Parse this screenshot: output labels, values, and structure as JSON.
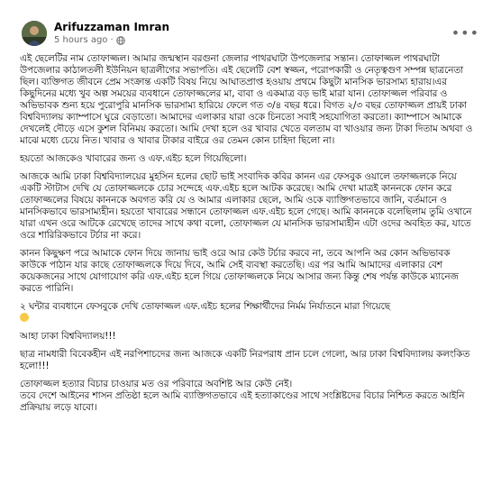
{
  "post": {
    "author": "Arifuzzaman Imran",
    "time": "5 hours ago",
    "separator": "·",
    "privacy_icon": "globe-icon",
    "menu_icon": "more-options-icon",
    "paragraphs": [
      "এই ছেলেটির নাম তোফাজ্জল। আমার জন্মস্থান বরগুনা জেলার পাথরঘাটা উপজেলার সন্তান। তোফাজ্জল পাথরঘাটা উপজেলার কাঠালতলী ইউনিয়ন ছাত্রলীগের সভাপতি। এই ছেলেটি বেশ স্বজ্জন, পরোপকারী ও নেতৃত্বগুণ সম্পন্ন ছাত্রনেতা ছিল। ব্যক্তিগত জীবনে প্রেম সংক্রান্ত একটি বিষয় নিয়ে আঘাতপ্রাপ্ত হওয়ায় প্রথমে কিছুটা মানসিক ভারসাম্য হারায়।এর কিছুদিনের মধ্যে খুব অল্প সময়ের ব্যবধানে তোফাজ্জলের মা, বাবা ও একমাত্র বড় ভাই মারা যান। তোফাজ্জল পরিবার ও অভিভাবক শুন্য হয়ে পুরোপুরি মানসিক ভারসাম্য হারিয়ে ফেলে গত ৩/৪ বছর ধরে। বিগত ২/৩ বছর তোফাজ্জল প্রায়ই ঢাকা বিশ্ববিদ্যালয় ক্যাম্পাসে ঘুরে বেড়াতো। আমাদের এলাকার যারা ওকে চিনতো সবাই সহযোগিতা করতো। ক্যাম্পাসে আমাকে দেখলেই দৌড়ে এসে কুশল বিনিময় করতো। আমি দেখা হলে ওর খাবার খেতে বলতাম বা খাওয়ার জন্য টাকা দিতাম অথবা ও মাঝে মধ্যে চেয়ে নিত। খাবার ও খাবার টাকার বাইরে ওর তেমন কোন চাহিদা ছিলো না।",
      "হয়তো আজকেও খাবারের জন্য ও এফ.এইচ হলে গিয়েছিলো।",
      "আজকে আমি ঢাকা বিশ্ববিদ্যালয়ের মুহসিন হলের ছোট ভাই সংবাদিক কবির কানন এর ফেসবুক ওয়ালে তফাজ্জলকে নিয়ে একটি স্টাটাস দেখি যে তোফাজ্জলকে চোর সন্দেহে এফ.এইচ হলে আটক করেছে। আমি দেখা মাত্রই কাননকে ফোন করে তোফাজ্জলের বিষয়ে কাননকে অবগত করি যে ও আমার এলাকার ছেলে, আমি ওকে ব্যাক্তিগতভাবে জানি, বর্তমানে ও মানসিকভাবে ভারসাম্যহীন। হয়তো খাবারের সন্ধানে তোফাজ্জল এফ.এইচ হলে গেছে। আমি কাননকে বলেছিলাম তুমি ওখানে যারা এখন ওরে আটকে রেখেছে তাদের সাথে কথা বলো, তোফাজ্জল যে মানসিক ভারসাম্যহীন এটা ওদের অবহিত কর, যাতে ওরে শারিরিকভাবে টর্চার না করে।",
      "কানন কিছুক্ষণ পরে আমাকে ফোন দিয়ে জানায় ভাই ওরে আর কেউ টর্চার করবে না, তবে আপনি অর কোন অভিভাবক কাউকে পাঠান যার কাছে তোফাজ্জলকে দিয়ে দিবে, আমি সেই ব্যবস্থা করতেছি। এর পর আমি আমাদের এলাকার বেশ কয়েকজনের সাথে যোগাযোগ করি এফ.এইচ হলে গিয়ে তোফাজ্জলকে নিয়ে আসার জন্য কিন্তু শেষ পর্যন্ত কাউকে ম্যানেজ করতে পারিনি।",
      "২ ঘন্টার ব্যবধানে ফেসবুকে দেখি তোফাজ্জল এফ.এইচ হলের শিক্ষার্থীদের নির্মম নির্যাতনে মারা গিয়েছে",
      "আহা ঢাকা বিশ্ববিদ্যালয়!!!",
      "ছাত্র নামধারী বিবেকহীন এই নরপিশাচদের জন্য আজকে একটি নিরপরাধ প্রান চলে গেলো, আর ঢাকা বিশ্ববিদ্যালয় কলংকিত হলো!!!",
      "তোফাজ্জল হত্যার বিচার চাওয়ার মত ওর পরিবারে অবশিষ্ট আর কেউ নেই।",
      "তবে দেশে আইনের শাসন প্রতিষ্ঠা হলে আমি ব্যাক্তিগতভাবে এই হত্যাকাণ্ডের সাথে সংশ্লিষ্টদের বিচার নিশ্চিত করতে আইনি প্রক্রিয়ায় লড়ে যাবো।"
    ],
    "sad_emoji_icon": "sad-face-emoji-icon"
  }
}
